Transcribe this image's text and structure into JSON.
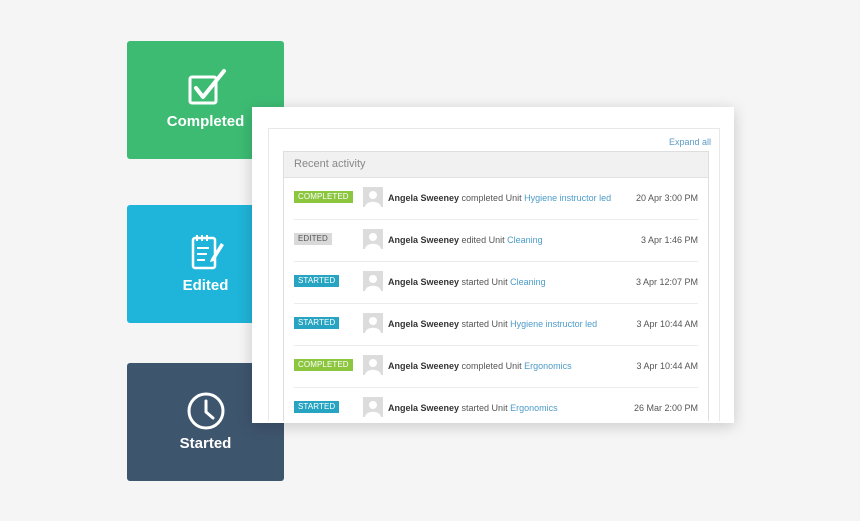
{
  "tiles": [
    {
      "label": "Completed",
      "icon": "checkbox-icon",
      "color": "#3dbb73"
    },
    {
      "label": "Edited",
      "icon": "notepad-icon",
      "color": "#1fb4d9"
    },
    {
      "label": "Started",
      "icon": "clock-icon",
      "color": "#3e556e"
    }
  ],
  "card": {
    "expand_all": "Expand all",
    "panel_title": "Recent activity"
  },
  "activity": [
    {
      "badge": "COMPLETED",
      "user": "Angela Sweeney",
      "action": "completed Unit",
      "unit": "Hygiene instructor led",
      "date": "20 Apr 3:00 PM"
    },
    {
      "badge": "EDITED",
      "user": "Angela Sweeney",
      "action": "edited Unit",
      "unit": "Cleaning",
      "date": "3 Apr 1:46 PM"
    },
    {
      "badge": "STARTED",
      "user": "Angela Sweeney",
      "action": "started Unit",
      "unit": "Cleaning",
      "date": "3 Apr 12:07 PM"
    },
    {
      "badge": "STARTED",
      "user": "Angela Sweeney",
      "action": "started Unit",
      "unit": "Hygiene instructor led",
      "date": "3 Apr 10:44 AM"
    },
    {
      "badge": "COMPLETED",
      "user": "Angela Sweeney",
      "action": "completed Unit",
      "unit": "Ergonomics",
      "date": "3 Apr 10:44 AM"
    },
    {
      "badge": "STARTED",
      "user": "Angela Sweeney",
      "action": "started Unit",
      "unit": "Ergonomics",
      "date": "26 Mar 2:00 PM"
    }
  ],
  "colors": {
    "completed_badge": "#8cc63f",
    "edited_badge": "#d9d9d9",
    "started_badge": "#27a4c1",
    "link": "#4c9bc9"
  }
}
